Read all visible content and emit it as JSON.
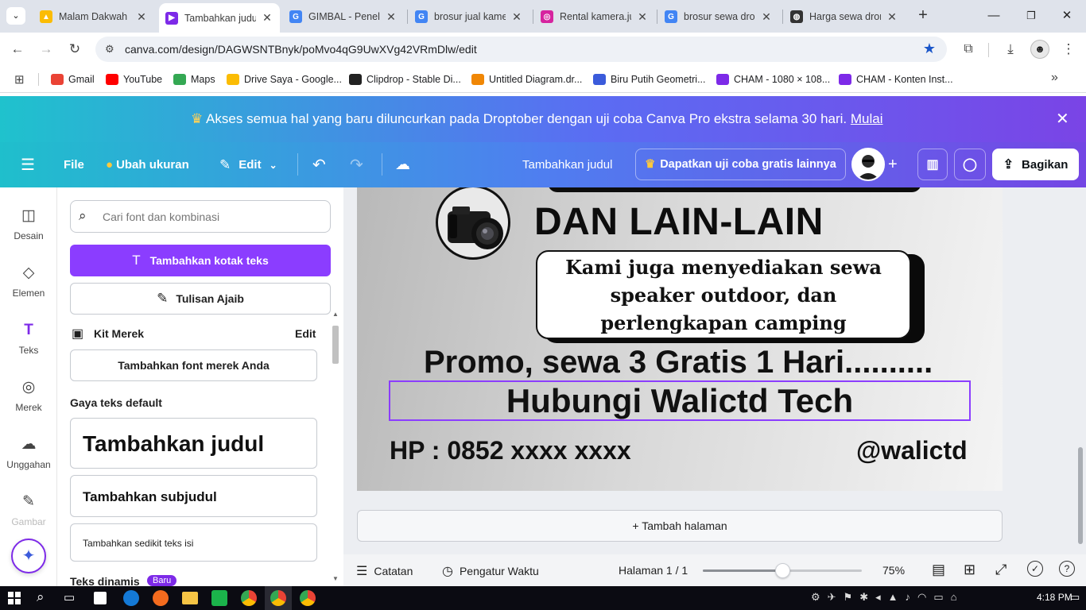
{
  "browser": {
    "tabs": [
      {
        "title": "Malam Dakwah -",
        "icon": "google-drive-icon",
        "active": false
      },
      {
        "title": "Tambahkan judu",
        "icon": "canva-icon",
        "active": true
      },
      {
        "title": "GIMBAL - Penelu",
        "icon": "google-icon",
        "active": false
      },
      {
        "title": "brosur jual kame",
        "icon": "google-icon",
        "active": false
      },
      {
        "title": "Rental kamera.ju",
        "icon": "instagram-icon",
        "active": false
      },
      {
        "title": "brosur sewa dro",
        "icon": "google-icon",
        "active": false
      },
      {
        "title": "Harga sewa dron",
        "icon": "globe-icon",
        "active": false
      }
    ],
    "new_tab": "+",
    "url": "canva.com/design/DAGWSNTBnyk/poMvo4qG9UwXVg42VRmDlw/edit",
    "bookmarks": [
      {
        "label": "Gmail",
        "color": "#ea4335"
      },
      {
        "label": "YouTube",
        "color": "#ff0000"
      },
      {
        "label": "Maps",
        "color": "#34a853"
      },
      {
        "label": "Drive Saya - Google...",
        "color": "#fbbc04"
      },
      {
        "label": "Clipdrop - Stable Di...",
        "color": "#222222"
      },
      {
        "label": "Untitled Diagram.dr...",
        "color": "#f08705"
      },
      {
        "label": "Biru Putih Geometri...",
        "color": "#3b5bdb"
      },
      {
        "label": "CHAM - 1080 × 108...",
        "color": "#7d2ae8"
      },
      {
        "label": "CHAM - Konten Inst...",
        "color": "#7d2ae8"
      }
    ]
  },
  "promo": {
    "text": "Akses semua hal yang baru diluncurkan pada Droptober dengan uji coba Canva Pro ekstra selama 30 hari.",
    "link": "Mulai"
  },
  "toolbar": {
    "file": "File",
    "resize": "Ubah ukuran",
    "edit": "Edit",
    "title": "Tambahkan judul",
    "trial": "Dapatkan uji coba gratis lainnya",
    "share": "Bagikan"
  },
  "rail": [
    {
      "label": "Desain",
      "icon": "layout-icon"
    },
    {
      "label": "Elemen",
      "icon": "shapes-icon"
    },
    {
      "label": "Teks",
      "icon": "text-icon"
    },
    {
      "label": "Merek",
      "icon": "brand-icon"
    },
    {
      "label": "Unggahan",
      "icon": "upload-icon"
    },
    {
      "label": "Gambar",
      "icon": "draw-icon"
    }
  ],
  "panel": {
    "search_placeholder": "Cari font dan kombinasi",
    "add_textbox": "Tambahkan kotak teks",
    "magic_write": "Tulisan Ajaib",
    "brand_kit": "Kit Merek",
    "brand_edit": "Edit",
    "add_brand_font": "Tambahkan font merek Anda",
    "default_styles": "Gaya teks default",
    "heading": "Tambahkan judul",
    "subheading": "Tambahkan subjudul",
    "body": "Tambahkan sedikit teks isi",
    "dynamic": "Teks dinamis",
    "new_badge": "Baru"
  },
  "design": {
    "line1": "DAN LAIN-LAIN",
    "bubble": "Kami juga menyediakan sewa speaker outdoor, dan perlengkapan camping",
    "promo": "Promo, sewa 3 Gratis 1 Hari..........",
    "contact": "Hubungi Walictd Tech",
    "phone": "HP : 0852 xxxx xxxx",
    "handle": "@walictd"
  },
  "add_page": "+ Tambah halaman",
  "bottom": {
    "notes": "Catatan",
    "timer": "Pengatur Waktu",
    "page": "Halaman 1 / 1",
    "zoom": "75%",
    "zoom_level": 0.5
  },
  "taskbar": {
    "time": "4:18 PM"
  }
}
